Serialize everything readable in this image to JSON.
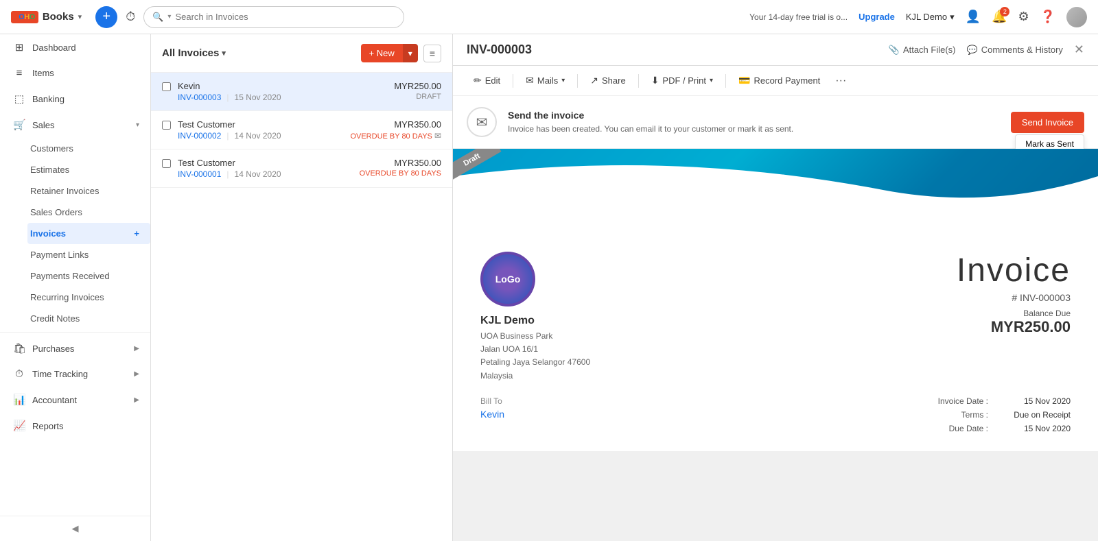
{
  "app": {
    "logo_text": "ZOHO",
    "logo_books": "Books",
    "logo_caret": "▾"
  },
  "topnav": {
    "search_placeholder": "Search in Invoices",
    "trial_text": "Your 14-day free trial is o...",
    "upgrade_label": "Upgrade",
    "org_name": "KJL Demo",
    "org_caret": "▾",
    "notification_count": "2"
  },
  "sidebar": {
    "items": [
      {
        "id": "dashboard",
        "label": "Dashboard",
        "icon": "⊞"
      },
      {
        "id": "items",
        "label": "Items",
        "icon": "☰"
      },
      {
        "id": "banking",
        "label": "Banking",
        "icon": "🏦"
      },
      {
        "id": "sales",
        "label": "Sales",
        "icon": "🛒",
        "has_caret": true,
        "expanded": true
      }
    ],
    "sales_sub": [
      {
        "id": "customers",
        "label": "Customers"
      },
      {
        "id": "estimates",
        "label": "Estimates"
      },
      {
        "id": "retainer-invoices",
        "label": "Retainer Invoices"
      },
      {
        "id": "sales-orders",
        "label": "Sales Orders"
      },
      {
        "id": "invoices",
        "label": "Invoices",
        "active": true
      },
      {
        "id": "payment-links",
        "label": "Payment Links"
      },
      {
        "id": "payments-received",
        "label": "Payments Received"
      },
      {
        "id": "recurring-invoices",
        "label": "Recurring Invoices"
      },
      {
        "id": "credit-notes",
        "label": "Credit Notes"
      }
    ],
    "bottom_items": [
      {
        "id": "purchases",
        "label": "Purchases",
        "icon": "🛍",
        "has_caret": true
      },
      {
        "id": "time-tracking",
        "label": "Time Tracking",
        "icon": "⏱",
        "has_caret": true
      },
      {
        "id": "accountant",
        "label": "Accountant",
        "icon": "📊",
        "has_caret": true
      },
      {
        "id": "reports",
        "label": "Reports",
        "icon": "📈"
      }
    ],
    "collapse_icon": "◀"
  },
  "invoice_list": {
    "title": "All Invoices",
    "title_caret": "▾",
    "new_button": "+ New",
    "new_caret": "▾",
    "invoices": [
      {
        "customer": "Kevin",
        "inv_num": "INV-000003",
        "date": "15 Nov 2020",
        "amount": "MYR250.00",
        "status": "DRAFT",
        "status_type": "draft",
        "has_mail": false,
        "selected": true
      },
      {
        "customer": "Test Customer",
        "inv_num": "INV-000002",
        "date": "14 Nov 2020",
        "amount": "MYR350.00",
        "status": "OVERDUE BY 80 DAYS",
        "status_type": "overdue",
        "has_mail": true,
        "selected": false
      },
      {
        "customer": "Test Customer",
        "inv_num": "INV-000001",
        "date": "14 Nov 2020",
        "amount": "MYR350.00",
        "status": "OVERDUE BY 80 DAYS",
        "status_type": "overdue",
        "has_mail": false,
        "selected": false
      }
    ]
  },
  "detail": {
    "inv_number": "INV-000003",
    "attach_label": "Attach File(s)",
    "comments_label": "Comments & History",
    "toolbar": {
      "edit": "Edit",
      "mails": "Mails",
      "share": "Share",
      "pdf_print": "PDF / Print",
      "record_payment": "Record Payment"
    },
    "send_banner": {
      "title": "Send the invoice",
      "description": "Invoice has been created. You can email it to your customer or mark it as sent.",
      "send_button": "Send Invoice",
      "mark_sent_button": "Mark as Sent"
    },
    "invoice": {
      "logo_text": "LoGo",
      "draft_ribbon": "Draft",
      "big_title": "Invoice",
      "inv_ref": "# INV-000003",
      "balance_label": "Balance Due",
      "balance_amount": "MYR250.00",
      "company_name": "KJL Demo",
      "company_address": [
        "UOA Business Park",
        "Jalan UOA 16/1",
        "Petaling Jaya Selangor 47600",
        "Malaysia"
      ],
      "bill_to_label": "Bill To",
      "bill_to_name": "Kevin",
      "invoice_date_label": "Invoice Date :",
      "invoice_date": "15 Nov 2020",
      "terms_label": "Terms :",
      "terms": "Due on Receipt",
      "due_date_label": "Due Date :",
      "due_date": "15 Nov 2020"
    }
  }
}
